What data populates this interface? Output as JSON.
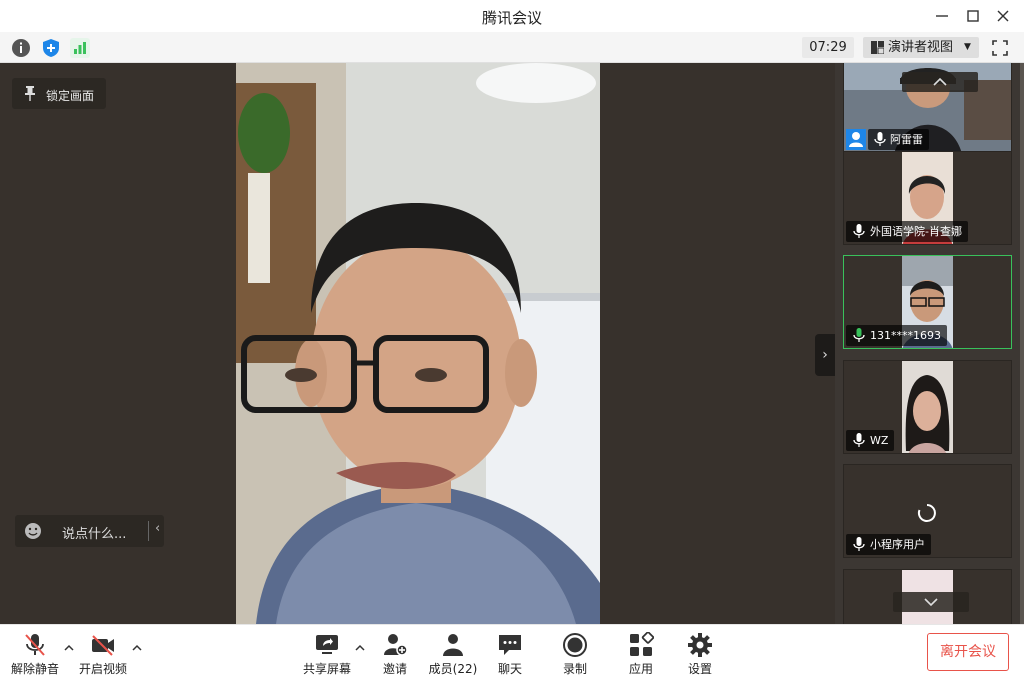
{
  "window": {
    "title": "腾讯会议"
  },
  "infobar": {
    "timer": "07:29",
    "view_mode": "演讲者视图"
  },
  "stage": {
    "lock_label": "锁定画面",
    "chat_placeholder": "说点什么..."
  },
  "participants": [
    {
      "name": "阿雷雷",
      "host": true,
      "speaking": false
    },
    {
      "name": "外国语学院-肖查娜",
      "host": false,
      "speaking": false
    },
    {
      "name": "131****1693",
      "host": false,
      "speaking": true
    },
    {
      "name": "WZ",
      "host": false,
      "speaking": false
    },
    {
      "name": "小程序用户",
      "host": false,
      "speaking": false,
      "loading": true
    },
    {
      "name": "",
      "host": false,
      "speaking": false
    }
  ],
  "toolbar": {
    "unmute": "解除静音",
    "start_video": "开启视频",
    "share_screen": "共享屏幕",
    "invite": "邀请",
    "members": "成员(22)",
    "chat": "聊天",
    "record": "录制",
    "apps": "应用",
    "settings": "设置",
    "leave": "离开会议"
  },
  "colors": {
    "accent_green": "#39c15b",
    "leave_red": "#e8534a",
    "host_blue": "#1e86e8",
    "stage_bg": "#37312c"
  }
}
